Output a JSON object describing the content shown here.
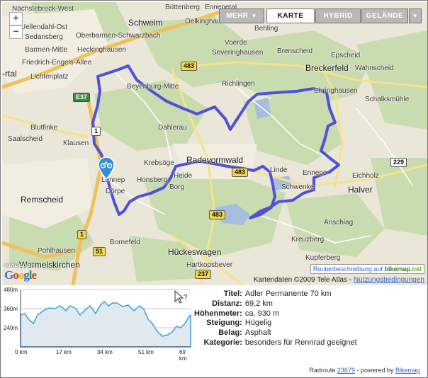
{
  "map": {
    "controls": {
      "zoom_in": "+",
      "zoom_out": "−"
    },
    "type_buttons": [
      {
        "label": "MEHR",
        "has_dropdown": true,
        "active": false
      },
      {
        "label": "KARTE",
        "has_dropdown": false,
        "active": true
      },
      {
        "label": "HYBRID",
        "has_dropdown": false,
        "active": false
      },
      {
        "label": "GELÄNDE",
        "has_dropdown": true,
        "active": false
      }
    ],
    "places": [
      "Büttenberg",
      "Nächstebreck-West",
      "Ennepetal",
      "Uellendahl-Ost",
      "Sedansberg",
      "Oberbarmen-Schwarzbach",
      "Barmen-Mitte",
      "Heckinghausen",
      "Friedrich-Engels-Allee",
      "Lichtenplatz",
      "Schwelm",
      "Oelkinghausen",
      "Behling",
      "Voerde",
      "Severinghausen",
      "Brenscheid",
      "Epscheid",
      "Breckerfeld",
      "Wahnscheid",
      "Beyenburg-Mitte",
      "Richlingen",
      "Ehringhausen",
      "Schalksmühle",
      "Blutfinke",
      "Klausen",
      "Dahlerau",
      "Radevormwald",
      "Linde",
      "Ennepe",
      "Eichholz",
      "Halver",
      "Krebsöge",
      "Honsberg",
      "Lennep",
      "Remscheid",
      "Borg",
      "Schwenke",
      "Bornefeld",
      "Anschlag",
      "Kreuzberg",
      "Pohlhausen",
      "Hückeswagen",
      "Kupferberg",
      "Wermelskirchen",
      "Hartkopsbever",
      "Saalscheid",
      "-rtal",
      "Dörpe",
      "Heide"
    ],
    "road_shields": [
      "483",
      "E37",
      "1",
      "483",
      "229",
      "483",
      "1",
      "51",
      "237"
    ],
    "attribution": {
      "text": "Kartendaten ©2009 Tele Atlas -",
      "link": "Nutzungsbedingungen"
    },
    "bikemap_link": {
      "text": "Routenbeschreibung auf",
      "brand1": "bikemap",
      "brand2": ".net"
    },
    "powered_by": "POWERED BY",
    "google": "Google",
    "route_color": "#5050d8"
  },
  "profile": {
    "y_labels": [
      "480m",
      "360m",
      "240m"
    ],
    "x_labels": [
      "0 km",
      "17 km",
      "34 km",
      "51 km",
      "69 km"
    ]
  },
  "info": {
    "rows": [
      {
        "key": "Titel:",
        "value": "Adler Permanente 70 km"
      },
      {
        "key": "Distanz:",
        "value": "69,2 km"
      },
      {
        "key": "Höhenmeter:",
        "value": "ca. 930 m"
      },
      {
        "key": "Steigung:",
        "value": "Hügelig"
      },
      {
        "key": "Belag:",
        "value": "Asphalt"
      },
      {
        "key": "Kategorie:",
        "value": "besonders für Rennrad geeignet"
      }
    ]
  },
  "footer": {
    "text": "Radroute",
    "route_id": "23679",
    "middle": " - powered by ",
    "brand": "Bikemap"
  }
}
